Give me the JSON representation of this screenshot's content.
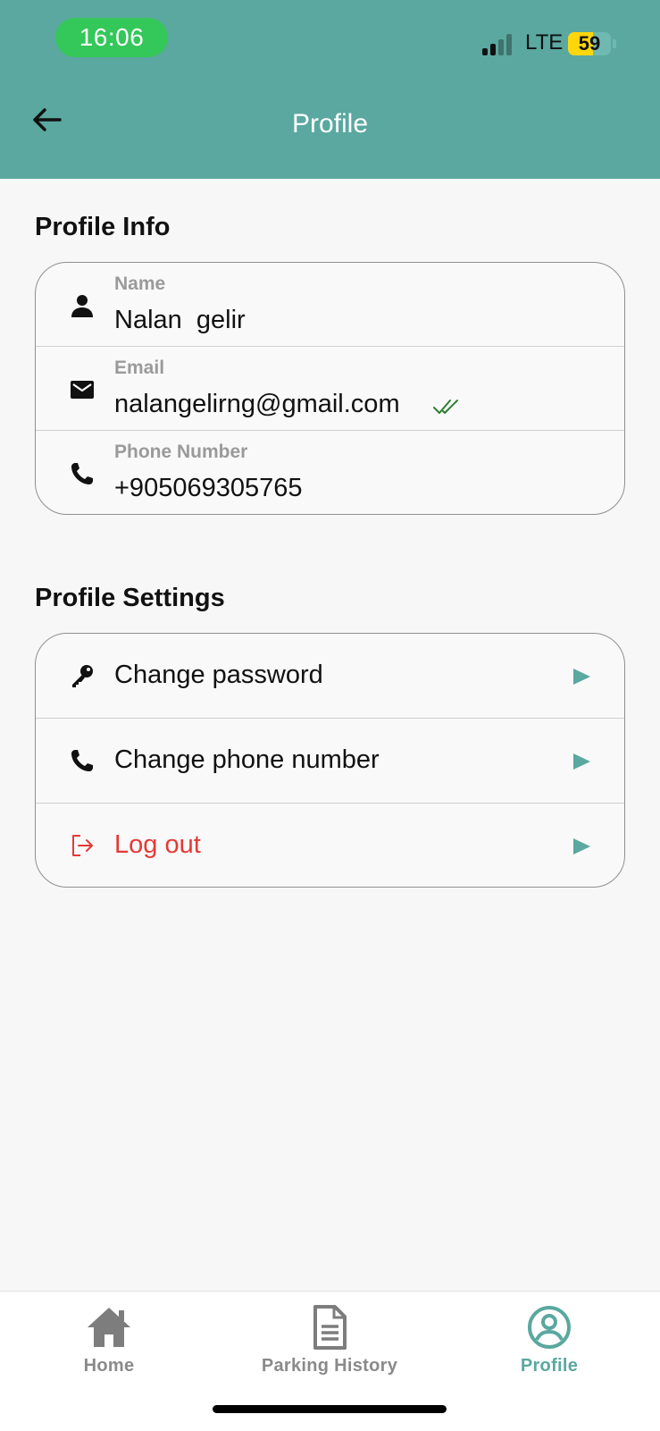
{
  "status_bar": {
    "time": "16:06",
    "network": "LTE",
    "battery": "59",
    "battery_level": 0.59
  },
  "header": {
    "title": "Profile",
    "back_icon": "arrow-left-icon"
  },
  "profile_info": {
    "title": "Profile Info",
    "name": {
      "label": "Name",
      "value": "Nalan  gelir",
      "icon": "person-icon"
    },
    "email": {
      "label": "Email",
      "value": "nalangelirng@gmail.com",
      "icon": "mail-icon",
      "verified_icon": "double-check-icon"
    },
    "phone": {
      "label": "Phone Number",
      "value": "+905069305765",
      "icon": "phone-icon"
    }
  },
  "profile_settings": {
    "title": "Profile Settings",
    "items": [
      {
        "label": "Change password",
        "icon": "key-icon"
      },
      {
        "label": "Change phone number",
        "icon": "phone-icon"
      },
      {
        "label": "Log out",
        "icon": "logout-icon"
      }
    ]
  },
  "bottom_nav": {
    "items": [
      {
        "label": "Home",
        "icon": "home-icon"
      },
      {
        "label": "Parking History",
        "icon": "document-icon"
      },
      {
        "label": "Profile",
        "icon": "account-circle-icon"
      }
    ],
    "active": "Profile"
  },
  "colors": {
    "primary": "#5aa8a0",
    "danger": "#e53935",
    "verified": "#2e7d32",
    "time_pill": "#34c759"
  }
}
